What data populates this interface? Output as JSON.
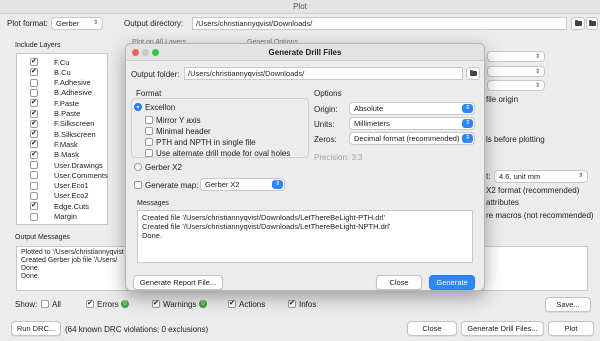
{
  "window": {
    "title": "Plot"
  },
  "toolbar": {
    "plot_format_label": "Plot format:",
    "plot_format_value": "Gerber",
    "output_dir_label": "Output directory:",
    "output_dir_value": "/Users/christiannyqvist/Downloads/"
  },
  "layers": {
    "header": "Include Layers",
    "items": [
      {
        "name": "F.Cu",
        "checked": true
      },
      {
        "name": "B.Cu",
        "checked": true
      },
      {
        "name": "F.Adhesive",
        "checked": false
      },
      {
        "name": "B.Adhesive",
        "checked": false
      },
      {
        "name": "F.Paste",
        "checked": true
      },
      {
        "name": "B.Paste",
        "checked": true
      },
      {
        "name": "F.Silkscreen",
        "checked": true
      },
      {
        "name": "B.Silkscreen",
        "checked": true
      },
      {
        "name": "F.Mask",
        "checked": true
      },
      {
        "name": "B.Mask",
        "checked": true
      },
      {
        "name": "User.Drawings",
        "checked": false
      },
      {
        "name": "User.Comments",
        "checked": false
      },
      {
        "name": "User.Eco1",
        "checked": false
      },
      {
        "name": "User.Eco2",
        "checked": false
      },
      {
        "name": "Edge.Cuts",
        "checked": true
      },
      {
        "name": "Margin",
        "checked": false
      }
    ]
  },
  "background": {
    "plot_on_all_layers": "Plot on All Layers",
    "general_options": "General Options",
    "file_origin_text": "file origin",
    "pads_before_plotting": "ls before plotting",
    "coord_value": "4.6, unit mm",
    "x2_format": "X2 format (recommended)",
    "attributes": "attributes",
    "macros": "re macros (not recommended)"
  },
  "output_messages": {
    "header": "Output Messages",
    "text": "Plotted to '/Users/christiannyqvist\nCreated Gerber job file '/Users/\nDone.\nDone."
  },
  "filters": {
    "show_label": "Show:",
    "all": "All",
    "errors": "Errors",
    "errors_count": "0",
    "warnings": "Warnings",
    "warnings_count": "0",
    "actions": "Actions",
    "infos": "Infos",
    "save": "Save..."
  },
  "footer": {
    "run_drc": "Run DRC...",
    "drc_info": "(64 known DRC violations; 0 exclusions)",
    "close": "Close",
    "generate_drill": "Generate Drill Files...",
    "plot": "Plot"
  },
  "dialog": {
    "title": "Generate Drill Files",
    "output_folder_label": "Output folder:",
    "output_folder_value": "/Users/christiannyqvist/Downloads/",
    "format_header": "Format",
    "excellon": "Excellon",
    "mirror_y": "Mirror Y axis",
    "minimal_header": "Minimal header",
    "pth_npth": "PTH and NPTH in single file",
    "alt_drill": "Use alternate drill mode for oval holes",
    "gerber_x2": "Gerber X2",
    "gen_map_label": "Generate map:",
    "gen_map_value": "Gerber X2",
    "options_header": "Options",
    "origin_label": "Origin:",
    "origin_value": "Absolute",
    "units_label": "Units:",
    "units_value": "Millimeters",
    "zeros_label": "Zeros:",
    "zeros_value": "Decimal format (recommended)",
    "precision": "Precision: 3:3",
    "messages_header": "Messages",
    "messages_text": "Created file '/Users/christiannyqvist/Downloads/LetThereBeLight-PTH.drl'\nCreated file '/Users/christiannyqvist/Downloads/LetThereBeLight-NPTH.drl'\nDone.",
    "report_button": "Generate Report File...",
    "close_button": "Close",
    "generate_button": "Generate"
  }
}
